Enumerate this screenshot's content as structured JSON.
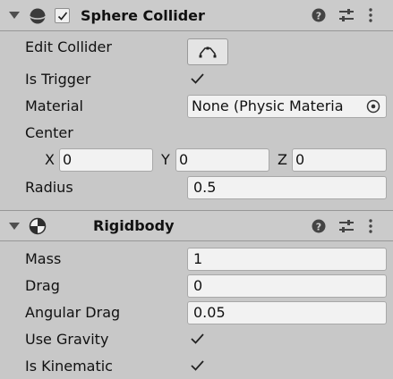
{
  "sphere_collider": {
    "title": "Sphere Collider",
    "enabled": true,
    "edit_collider_label": "Edit Collider",
    "is_trigger_label": "Is Trigger",
    "is_trigger": true,
    "material_label": "Material",
    "material_value": "None (Physic Materia",
    "center_label": "Center",
    "center": {
      "x_label": "X",
      "x": "0",
      "y_label": "Y",
      "y": "0",
      "z_label": "Z",
      "z": "0"
    },
    "radius_label": "Radius",
    "radius": "0.5"
  },
  "rigidbody": {
    "title": "Rigidbody",
    "mass_label": "Mass",
    "mass": "1",
    "drag_label": "Drag",
    "drag": "0",
    "angular_drag_label": "Angular Drag",
    "angular_drag": "0.05",
    "use_gravity_label": "Use Gravity",
    "use_gravity": true,
    "is_kinematic_label": "Is Kinematic",
    "is_kinematic": true
  },
  "icons": [
    "foldout-caret-icon",
    "sphere-collider-icon",
    "rigidbody-icon",
    "help-icon",
    "presets-icon",
    "more-options-icon",
    "edit-collider-icon",
    "object-picker-icon"
  ]
}
